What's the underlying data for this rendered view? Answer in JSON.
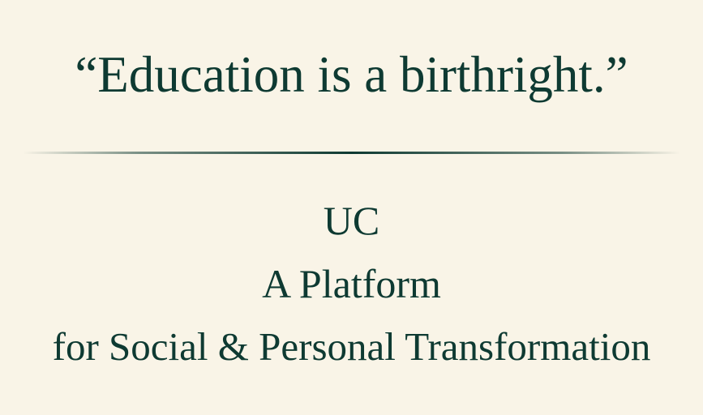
{
  "quote": "“Education is a birthright.”",
  "org": {
    "line1": "UC",
    "line2": "A Platform",
    "line3": "for Social & Personal Transformation"
  },
  "colors": {
    "background": "#f9f4e7",
    "text": "#0e3a32"
  }
}
